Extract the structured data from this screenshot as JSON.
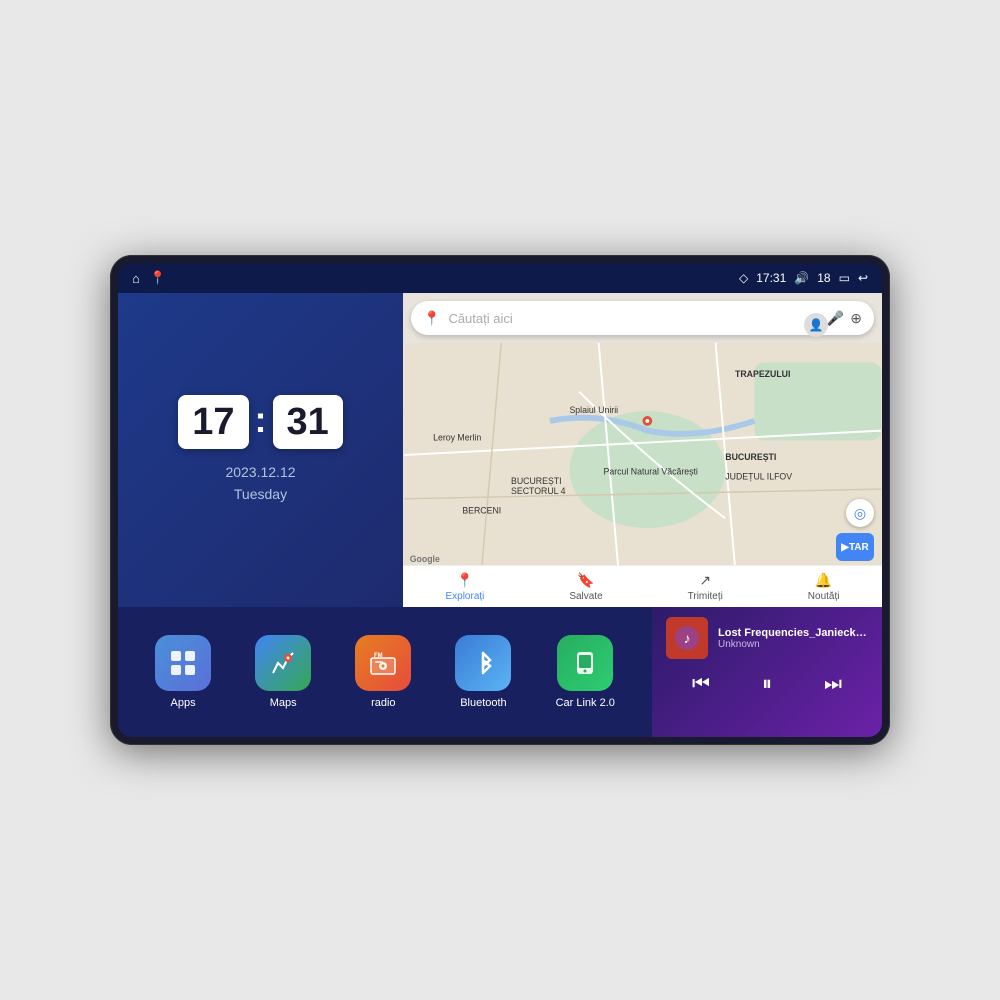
{
  "device": {
    "status_bar": {
      "gps_icon": "◇",
      "time": "17:31",
      "volume_icon": "🔊",
      "battery_level": "18",
      "battery_icon": "▭",
      "back_icon": "↩"
    },
    "nav_icons": {
      "home_icon": "⌂",
      "maps_icon": "📍"
    },
    "clock": {
      "hours": "17",
      "minutes": "31",
      "date": "2023.12.12",
      "weekday": "Tuesday"
    },
    "map": {
      "search_placeholder": "Căutați aici",
      "bottom_items": [
        {
          "icon": "📍",
          "label": "Explorați",
          "active": true
        },
        {
          "icon": "🔖",
          "label": "Salvate",
          "active": false
        },
        {
          "icon": "↗",
          "label": "Trimiteți",
          "active": false
        },
        {
          "icon": "🔔",
          "label": "Noutăți",
          "active": false
        }
      ],
      "map_labels": [
        "TRAPEZULUI",
        "BUCUREȘTI",
        "JUDEȚUL ILFOV",
        "BERCENI",
        "Parcul Natural Văcărești",
        "Leroy Merlin",
        "BUCUREȘTI\nSECTORUL 4",
        "Splaiul Unirii"
      ]
    },
    "apps": [
      {
        "id": "apps",
        "label": "Apps",
        "icon": "⊞",
        "color_class": "icon-apps"
      },
      {
        "id": "maps",
        "label": "Maps",
        "icon": "🗺",
        "color_class": "icon-maps"
      },
      {
        "id": "radio",
        "label": "radio",
        "icon": "📻",
        "color_class": "icon-radio",
        "badge": "FM"
      },
      {
        "id": "bluetooth",
        "label": "Bluetooth",
        "icon": "₿",
        "color_class": "icon-bluetooth"
      },
      {
        "id": "carlink",
        "label": "Car Link 2.0",
        "icon": "📱",
        "color_class": "icon-carlink"
      }
    ],
    "music": {
      "title": "Lost Frequencies_Janieck Devy-...",
      "artist": "Unknown",
      "thumbnail_emoji": "🎵",
      "prev_icon": "⏮",
      "play_icon": "⏸",
      "next_icon": "⏭"
    }
  }
}
